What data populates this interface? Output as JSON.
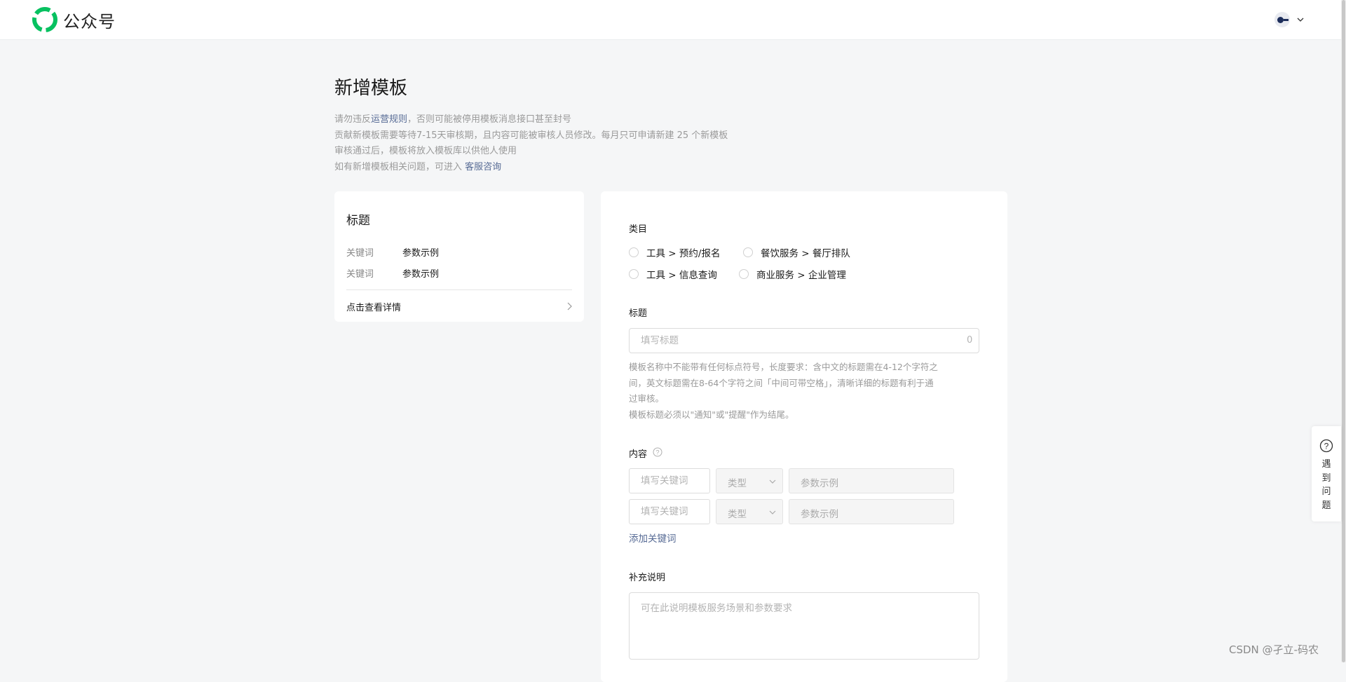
{
  "header": {
    "app_name": "公众号",
    "logo_icon": "wechat-official-account-logo",
    "account_menu_icon": "chevron-down-icon"
  },
  "page": {
    "title": "新增模板",
    "notice": {
      "line1_before": "请勿违反",
      "line1_link": "运营规则",
      "line1_after": "，否则可能被停用模板消息接口甚至封号",
      "line2": "贡献新模板需要等待7-15天审核期，且内容可能被审核人员修改。每月只可申请新建 25 个新模板",
      "line3": "审核通过后，模板将放入模板库以供他人使用",
      "line4_before": "如有新增模板相关问题，可进入 ",
      "line4_link": "客服咨询"
    }
  },
  "preview": {
    "title": "标题",
    "rows": [
      {
        "key": "关键词",
        "value": "参数示例"
      },
      {
        "key": "关键词",
        "value": "参数示例"
      }
    ],
    "detail_link": "点击查看详情"
  },
  "form": {
    "category_label": "类目",
    "categories": [
      "工具 > 预约/报名",
      "餐饮服务 > 餐厅排队",
      "工具 > 信息查询",
      "商业服务 > 企业管理"
    ],
    "title_label": "标题",
    "title_placeholder": "填写标题",
    "title_counter": "0",
    "title_hint": [
      "模板名称中不能带有任何标点符号，长度要求：含中文的标题需在4-12个字符之",
      "间，英文标题需在8-64个字符之间「中间可带空格」，清晰详细的标题有利于通",
      "过审核。",
      "模板标题必须以\"通知\"或\"提醒\"作为结尾。"
    ],
    "content_label": "内容",
    "keyword_rows": [
      {
        "keyword_placeholder": "填写关键词",
        "type_label": "类型",
        "example_placeholder": "参数示例"
      },
      {
        "keyword_placeholder": "填写关键词",
        "type_label": "类型",
        "example_placeholder": "参数示例"
      }
    ],
    "add_keyword": "添加关键词",
    "desc_label": "补充说明",
    "desc_placeholder": "可在此说明模板服务场景和参数要求"
  },
  "help_float": {
    "text": "遇到问题"
  },
  "watermark": "CSDN @孑立-码农",
  "colors": {
    "link": "#576b95",
    "brand_green": "#07c160",
    "page_bg": "#f5f6f7"
  }
}
